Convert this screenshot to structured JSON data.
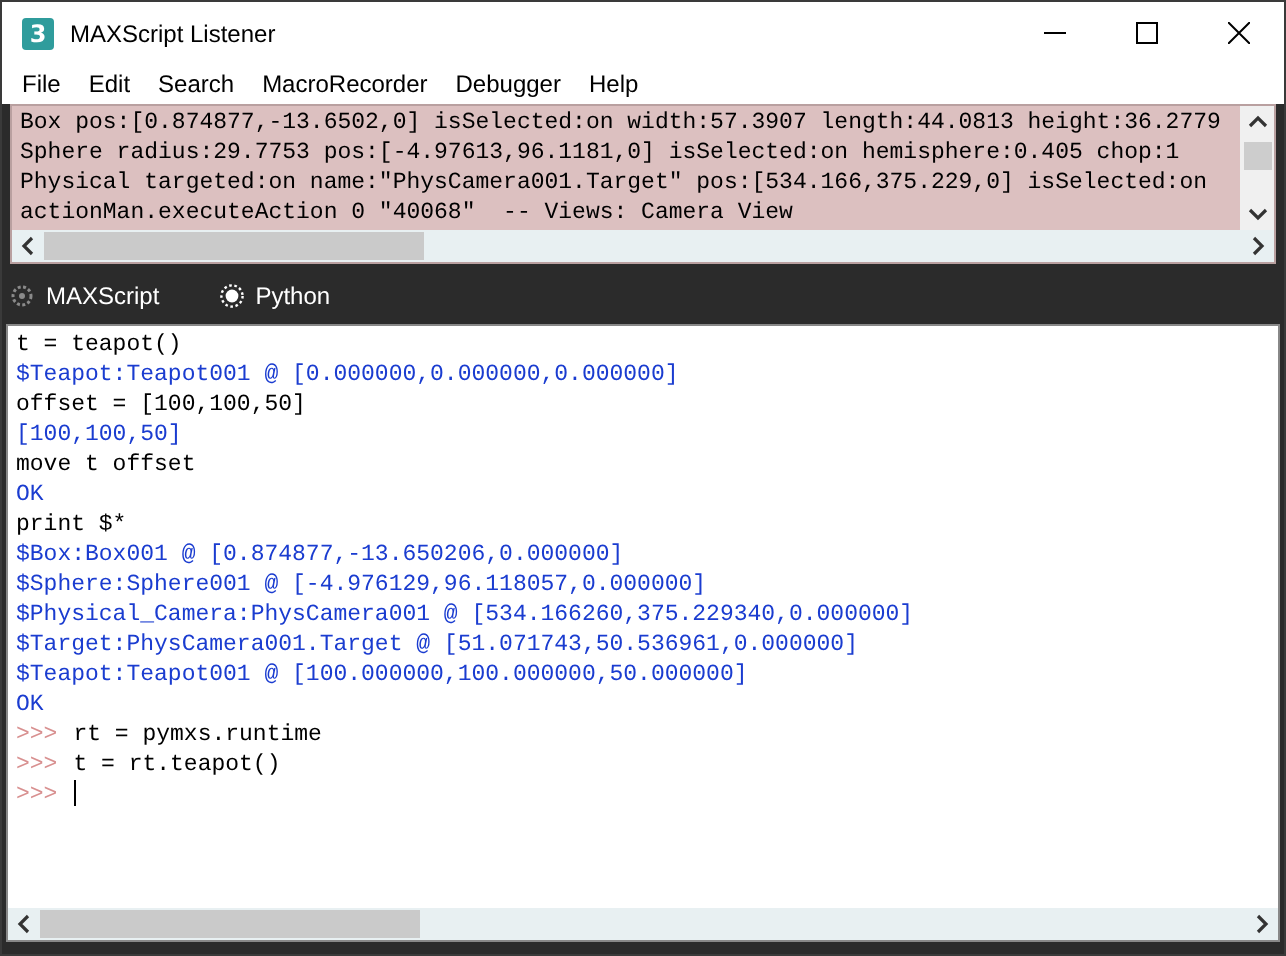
{
  "window": {
    "title": "MAXScript Listener",
    "app_icon": "3"
  },
  "menu": [
    "File",
    "Edit",
    "Search",
    "MacroRecorder",
    "Debugger",
    "Help"
  ],
  "macro_recorder": {
    "lines": [
      "Box pos:[0.874877,-13.6502,0] isSelected:on width:57.3907 length:44.0813 height:36.2779",
      "Sphere radius:29.7753 pos:[-4.97613,96.1181,0] isSelected:on hemisphere:0.405 chop:1",
      "Physical targeted:on name:\"PhysCamera001.Target\" pos:[534.166,375.229,0] isSelected:on",
      "actionMan.executeAction 0 \"40068\"  -- Views: Camera View"
    ]
  },
  "tabs": [
    {
      "label": "MAXScript",
      "selected": false
    },
    {
      "label": "Python",
      "selected": true
    }
  ],
  "listener": {
    "lines": [
      {
        "kind": "input",
        "text": "t = teapot()"
      },
      {
        "kind": "output",
        "text": "$Teapot:Teapot001 @ [0.000000,0.000000,0.000000]"
      },
      {
        "kind": "input",
        "text": "offset = [100,100,50]"
      },
      {
        "kind": "output",
        "text": "[100,100,50]"
      },
      {
        "kind": "input",
        "text": "move t offset"
      },
      {
        "kind": "output",
        "text": "OK"
      },
      {
        "kind": "input",
        "text": "print $*"
      },
      {
        "kind": "output",
        "text": "$Box:Box001 @ [0.874877,-13.650206,0.000000]"
      },
      {
        "kind": "output",
        "text": "$Sphere:Sphere001 @ [-4.976129,96.118057,0.000000]"
      },
      {
        "kind": "output",
        "text": "$Physical_Camera:PhysCamera001 @ [534.166260,375.229340,0.000000]"
      },
      {
        "kind": "output",
        "text": "$Target:PhysCamera001.Target @ [51.071743,50.536961,0.000000]"
      },
      {
        "kind": "output",
        "text": "$Teapot:Teapot001 @ [100.000000,100.000000,50.000000]"
      },
      {
        "kind": "output",
        "text": "OK"
      },
      {
        "kind": "python",
        "prompt": ">>>",
        "text": "rt = pymxs.runtime"
      },
      {
        "kind": "python",
        "prompt": ">>>",
        "text": "t = rt.teapot()"
      },
      {
        "kind": "cursor",
        "prompt": ">>>"
      }
    ]
  }
}
